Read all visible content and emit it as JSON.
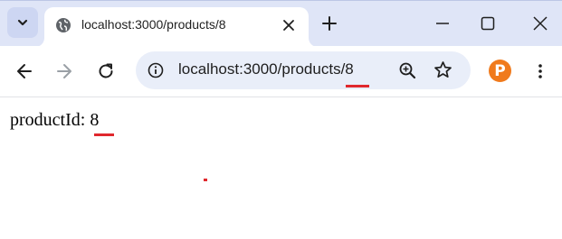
{
  "browser": {
    "tab": {
      "title": "localhost:3000/products/8",
      "favicon": "globe-icon"
    },
    "address_bar": {
      "url": "localhost:3000/products/8"
    },
    "extension": {
      "letter": "P",
      "color": "#f07a1c"
    },
    "icons": {
      "tab_search": "chevron-down-icon",
      "close_tab": "close-icon",
      "new_tab": "plus-icon",
      "minimize": "minimize-icon",
      "maximize": "maximize-icon",
      "close_window": "close-icon",
      "back": "arrow-left-icon",
      "forward": "arrow-right-icon",
      "reload": "reload-icon",
      "site_info": "info-icon",
      "zoom": "zoom-in-icon",
      "bookmark": "star-icon",
      "menu": "more-vert-icon"
    }
  },
  "page": {
    "param_label": "productId:",
    "param_value": "8"
  },
  "annotation": {
    "highlight_color": "#e0282d"
  }
}
